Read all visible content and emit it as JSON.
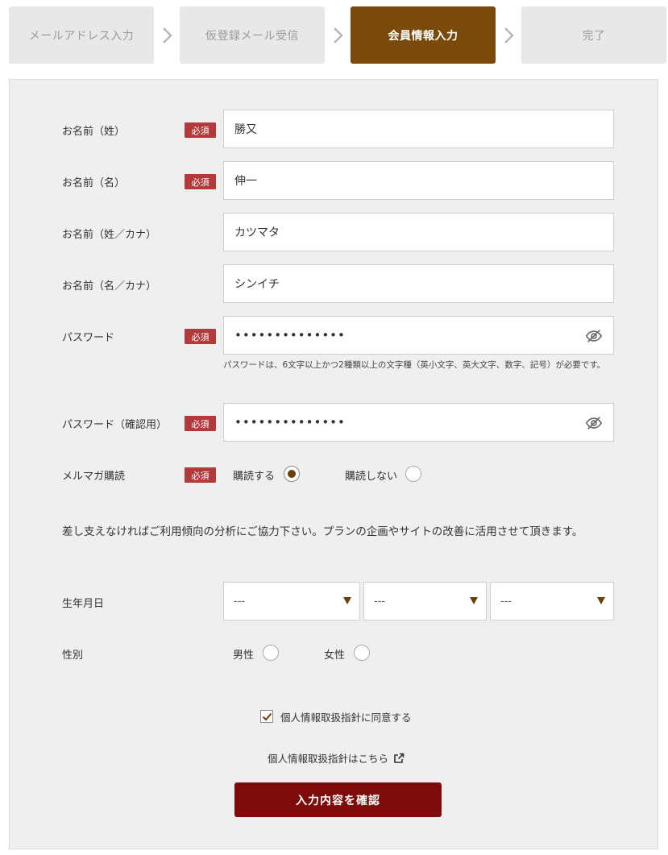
{
  "stepper": {
    "steps": [
      {
        "label": "メールアドレス入力"
      },
      {
        "label": "仮登録メール受信"
      },
      {
        "label": "会員情報入力"
      },
      {
        "label": "完了"
      }
    ],
    "active_index": 2,
    "active_color": "#7a4a0a"
  },
  "form": {
    "required_badge": "必須",
    "last_name": {
      "label": "お名前（姓）",
      "value": "勝又"
    },
    "first_name": {
      "label": "お名前（名）",
      "value": "伸一"
    },
    "last_name_kana": {
      "label": "お名前（姓／カナ）",
      "value": "カツマタ"
    },
    "first_name_kana": {
      "label": "お名前（名／カナ）",
      "value": "シンイチ"
    },
    "password": {
      "label": "パスワード",
      "value": "••••••••••••••",
      "icon": "eye-off-icon"
    },
    "password_hint": "パスワードは、6文字以上かつ2種類以上の文字種（英小文字、英大文字、数字、記号）が必要です。",
    "password_confirm": {
      "label": "パスワード（確認用）",
      "value": "••••••••••••••",
      "icon": "eye-off-icon"
    },
    "newsletter": {
      "label": "メルマガ購読",
      "options": [
        {
          "label": "購読する",
          "checked": true
        },
        {
          "label": "購読しない",
          "checked": false
        }
      ]
    },
    "survey_intro": "差し支えなければご利用傾向の分析にご協力下さい。プランの企画やサイトの改善に活用させて頂きます。",
    "birthdate": {
      "label": "生年月日",
      "year": "---",
      "month": "---",
      "day": "---"
    },
    "gender": {
      "label": "性別",
      "options": [
        {
          "label": "男性",
          "checked": false
        },
        {
          "label": "女性",
          "checked": false
        }
      ]
    },
    "agree": {
      "label": "個人情報取扱指針に同意する",
      "checked": true
    },
    "policy_link": {
      "label": "個人情報取扱指針はこちら",
      "icon": "external-link-icon"
    },
    "submit_label": "入力内容を確認",
    "submit_color": "#7e0a0a",
    "required_color": "#b33a3a"
  }
}
